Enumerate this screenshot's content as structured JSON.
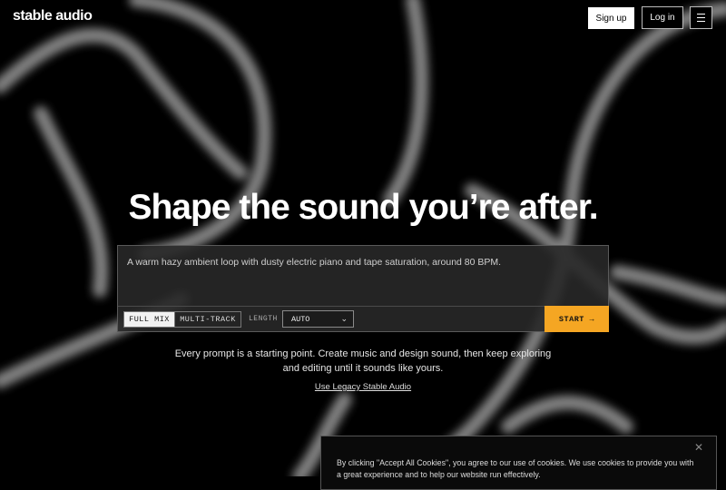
{
  "header": {
    "logo": "stable audio",
    "signup_label": "Sign up",
    "login_label": "Log in",
    "menu_icon": "menu-icon"
  },
  "hero": {
    "headline": "Shape the sound you’re after."
  },
  "prompt": {
    "text": "A warm hazy ambient loop with dusty electric piano and tape saturation, around 80 BPM.",
    "mode_full_mix": "FULL MIX",
    "mode_multi_track": "MULTI-TRACK",
    "selected_mode": "FULL MIX",
    "length_label": "LENGTH",
    "length_value": "AUTO",
    "start_label": "START →",
    "start_color": "#f5a623"
  },
  "subtext": {
    "line1": "Every prompt is a starting point. Create music and design sound, then keep exploring",
    "line2": "and editing until it sounds like yours."
  },
  "legacy_link": "Use Legacy Stable Audio",
  "cookie": {
    "line1": "By clicking \"Accept All Cookies\", you agree to our use of cookies. We use cookies to provide you with",
    "line2": "a great experience and to help our website run effectively."
  }
}
